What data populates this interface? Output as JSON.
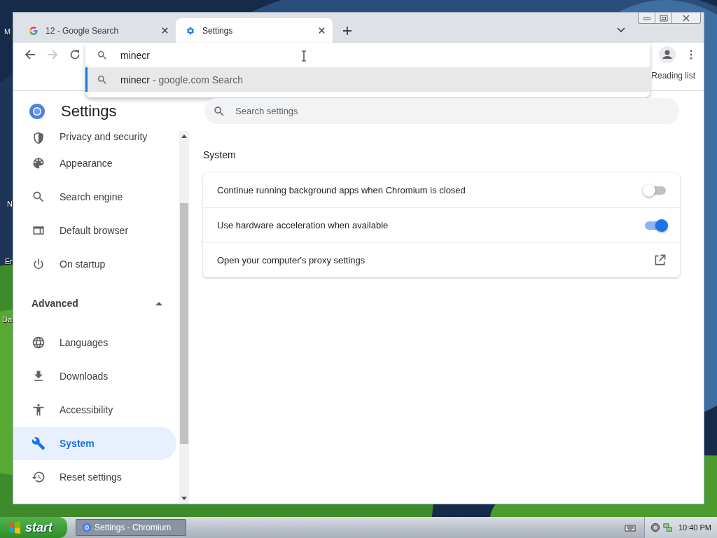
{
  "desktop": {
    "icon_labels": [
      "M",
      "N",
      "Er",
      "Da"
    ]
  },
  "browser": {
    "tabs": [
      {
        "title": "12 - Google Search",
        "selected": false
      },
      {
        "title": "Settings",
        "selected": true
      }
    ],
    "omnibox": {
      "value": "minecr",
      "suggestions": [
        {
          "query": "minecr",
          "source": " - google.com Search",
          "selected": true
        }
      ]
    },
    "reading_list": "Reading list"
  },
  "settings": {
    "title": "Settings",
    "search": {
      "placeholder": "Search settings"
    },
    "sidebar": {
      "items": [
        {
          "label": "Privacy and security",
          "selected": false
        },
        {
          "label": "Appearance",
          "selected": false
        },
        {
          "label": "Search engine",
          "selected": false
        },
        {
          "label": "Default browser",
          "selected": false
        },
        {
          "label": "On startup",
          "selected": false
        }
      ],
      "advanced": {
        "label": "Advanced",
        "expanded": true,
        "items": [
          {
            "label": "Languages",
            "selected": false
          },
          {
            "label": "Downloads",
            "selected": false
          },
          {
            "label": "Accessibility",
            "selected": false
          },
          {
            "label": "System",
            "selected": true
          },
          {
            "label": "Reset settings",
            "selected": false
          }
        ]
      }
    },
    "section": {
      "title": "System",
      "rows": [
        {
          "label": "Continue running background apps when Chromium is closed",
          "kind": "toggle",
          "on": false
        },
        {
          "label": "Use hardware acceleration when available",
          "kind": "toggle",
          "on": true
        },
        {
          "label": "Open your computer's proxy settings",
          "kind": "link"
        }
      ]
    }
  },
  "taskbar": {
    "start": "start",
    "tasks": [
      {
        "title": "Settings - Chromium",
        "selected": true
      }
    ],
    "clock": "10:40 PM"
  }
}
